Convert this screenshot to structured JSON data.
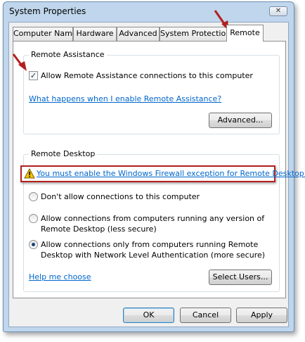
{
  "window": {
    "title": "System Properties",
    "close_glyph": "✕"
  },
  "tabs": [
    {
      "label": "Computer Name"
    },
    {
      "label": "Hardware"
    },
    {
      "label": "Advanced"
    },
    {
      "label": "System Protection"
    },
    {
      "label": "Remote",
      "active": true
    }
  ],
  "remote_assistance": {
    "group_title": "Remote Assistance",
    "checkbox_label": "Allow Remote Assistance connections to this computer",
    "checked": true,
    "help_link": "What happens when I enable Remote Assistance?",
    "advanced_button": "Advanced..."
  },
  "remote_desktop": {
    "group_title": "Remote Desktop",
    "warning_link": "You must enable the Windows Firewall exception for Remote Desktop.",
    "options": [
      {
        "line1": "Don't allow connections to this computer",
        "line2": "",
        "selected": false
      },
      {
        "line1": "Allow connections from computers running any version of",
        "line2": "Remote Desktop (less secure)",
        "selected": false
      },
      {
        "line1": "Allow connections only from computers running Remote",
        "line2": "Desktop with Network Level Authentication (more secure)",
        "selected": true
      }
    ],
    "help_link": "Help me choose",
    "select_users_button": "Select Users..."
  },
  "footer": {
    "ok": "OK",
    "cancel": "Cancel",
    "apply": "Apply"
  },
  "colors": {
    "annotation_red": "#b31f1f",
    "link_blue": "#0066cc",
    "title_bar": "#bfd6ec"
  },
  "icons": [
    "close-icon",
    "warning-icon",
    "annotation-arrow"
  ]
}
